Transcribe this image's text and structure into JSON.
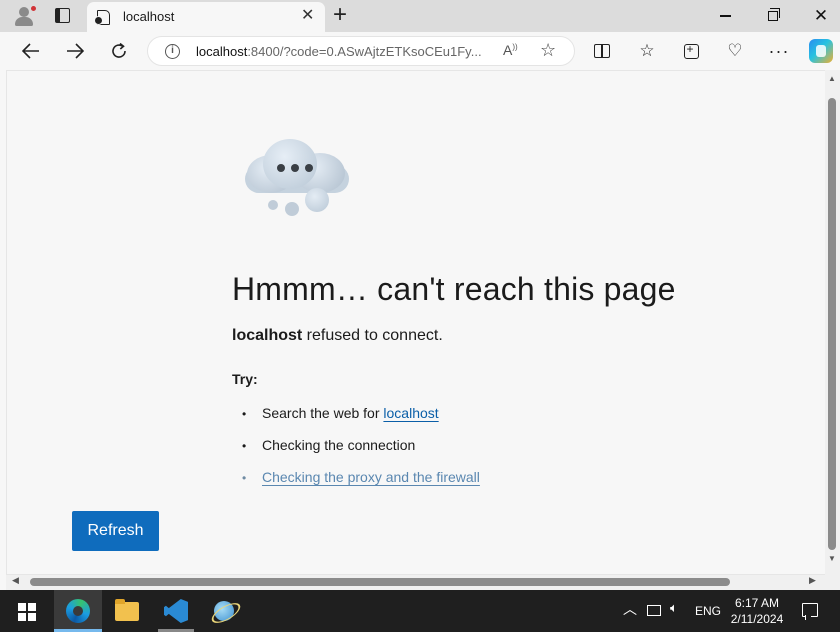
{
  "browser": {
    "tab_title": "localhost",
    "new_tab_label": "+",
    "tab_close_label": "✕",
    "address_host": "localhost",
    "address_rest": ":8400/?code=0.ASwAjtzETKsoCEu1Fy...",
    "read_aloud_label": "A̩",
    "window_close_label": "✕",
    "more_label": "···"
  },
  "error_page": {
    "heading": "Hmmm… can't reach this page",
    "host": "localhost",
    "message": " refused to connect.",
    "try_label": "Try:",
    "suggestions": [
      {
        "prefix": "Search the web for ",
        "link": "localhost"
      },
      {
        "text": "Checking the connection"
      },
      {
        "link": "Checking the proxy and the firewall"
      }
    ],
    "refresh_label": "Refresh"
  },
  "taskbar": {
    "language": "ENG",
    "time": "6:17 AM",
    "date": "2/11/2024"
  },
  "colors": {
    "accent": "#0f6cbd",
    "link": "#0b5fa8",
    "page_bg": "#f7f7f7",
    "taskbar_bg": "#1f1f1f"
  },
  "icons": [
    "profile-icon",
    "tab-actions-icon",
    "page-icon",
    "back-icon",
    "forward-icon",
    "refresh-icon",
    "info-icon",
    "read-aloud-icon",
    "favorite-star-icon",
    "split-screen-icon",
    "favorites-icon",
    "collections-icon",
    "browser-essentials-icon",
    "more-icon",
    "copilot-icon",
    "cloud-illustration-icon",
    "windows-start-icon",
    "edge-icon",
    "file-explorer-icon",
    "vscode-icon",
    "app-icon",
    "chevron-up-icon",
    "network-icon",
    "volume-icon",
    "notification-icon"
  ]
}
